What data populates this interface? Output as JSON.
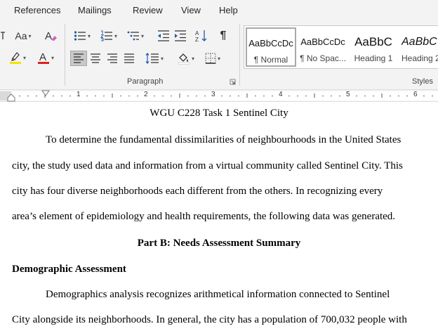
{
  "menu": {
    "tabs": [
      "References",
      "Mailings",
      "Review",
      "View",
      "Help"
    ]
  },
  "ribbon": {
    "font_group": {
      "change_case_label": "Aa",
      "highlight_color": "#f5e400",
      "font_color": "#e0201b"
    },
    "paragraph_group": {
      "label": "Paragraph",
      "paragraph_mark": "¶"
    },
    "styles_group": {
      "label": "Styles",
      "items": [
        {
          "sample": "AaBbCcDc",
          "name": "¶ Normal"
        },
        {
          "sample": "AaBbCcDc",
          "name": "¶ No Spac..."
        },
        {
          "sample": "AaBbC",
          "name": "Heading 1"
        },
        {
          "sample": "AaBbC",
          "name": "Heading 2"
        }
      ]
    }
  },
  "ruler": {
    "numbers": [
      "1",
      "2",
      "3",
      "4",
      "5",
      "6"
    ]
  },
  "document": {
    "title": "WGU C228 Task 1 Sentinel City",
    "paragraph1": [
      "To determine the fundamental dissimilarities of neighbourhoods in the United States",
      "city, the study used data and information from a virtual community called Sentinel City. This",
      "city has four diverse neighborhoods each different from the others. In recognizing every",
      "area’s element of epidemiology and health requirements, the following data was generated."
    ],
    "heading_b": "Part B: Needs Assessment Summary",
    "heading_demo": "Demographic Assessment",
    "paragraph2": [
      "Demographics analysis recognizes arithmetical information connected to Sentinel",
      "City alongside its neighborhoods. In general, the city has a population of 700,032 people with"
    ]
  }
}
